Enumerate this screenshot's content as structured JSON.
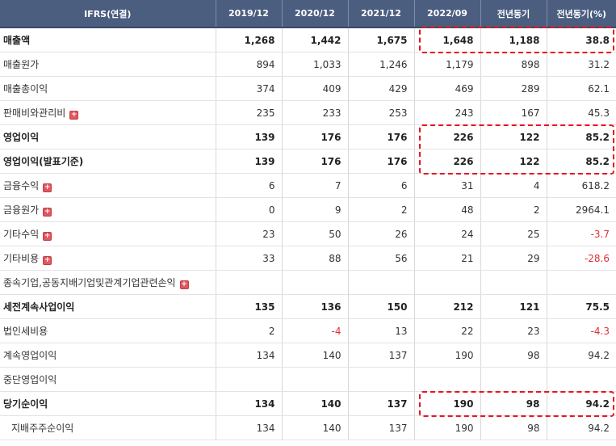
{
  "header": {
    "label": "IFRS(연결)",
    "periods": [
      "2019/12",
      "2020/12",
      "2021/12",
      "2022/09",
      "전년동기",
      "전년동기(%)"
    ]
  },
  "rows": [
    {
      "label": "매출액",
      "values": [
        "1,268",
        "1,442",
        "1,675",
        "1,648",
        "1,188",
        "38.8"
      ],
      "bold": true,
      "expandable": false
    },
    {
      "label": "매출원가",
      "values": [
        "894",
        "1,033",
        "1,246",
        "1,179",
        "898",
        "31.2"
      ],
      "bold": false,
      "expandable": false
    },
    {
      "label": "매출총이익",
      "values": [
        "374",
        "409",
        "429",
        "469",
        "289",
        "62.1"
      ],
      "bold": false,
      "expandable": false
    },
    {
      "label": "판매비와관리비",
      "values": [
        "235",
        "233",
        "253",
        "243",
        "167",
        "45.3"
      ],
      "bold": false,
      "expandable": true
    },
    {
      "label": "영업이익",
      "values": [
        "139",
        "176",
        "176",
        "226",
        "122",
        "85.2"
      ],
      "bold": true,
      "expandable": false
    },
    {
      "label": "영업이익(발표기준)",
      "values": [
        "139",
        "176",
        "176",
        "226",
        "122",
        "85.2"
      ],
      "bold": true,
      "expandable": false
    },
    {
      "label": "금융수익",
      "values": [
        "6",
        "7",
        "6",
        "31",
        "4",
        "618.2"
      ],
      "bold": false,
      "expandable": true
    },
    {
      "label": "금융원가",
      "values": [
        "0",
        "9",
        "2",
        "48",
        "2",
        "2964.1"
      ],
      "bold": false,
      "expandable": true
    },
    {
      "label": "기타수익",
      "values": [
        "23",
        "50",
        "26",
        "24",
        "25",
        "-3.7"
      ],
      "bold": false,
      "expandable": true
    },
    {
      "label": "기타비용",
      "values": [
        "33",
        "88",
        "56",
        "21",
        "29",
        "-28.6"
      ],
      "bold": false,
      "expandable": true
    },
    {
      "label": "종속기업,공동지배기업및관계기업관련손익",
      "values": [
        "",
        "",
        "",
        "",
        "",
        ""
      ],
      "bold": false,
      "expandable": true
    },
    {
      "label": "세전계속사업이익",
      "values": [
        "135",
        "136",
        "150",
        "212",
        "121",
        "75.5"
      ],
      "bold": true,
      "expandable": false
    },
    {
      "label": "법인세비용",
      "values": [
        "2",
        "-4",
        "13",
        "22",
        "23",
        "-4.3"
      ],
      "bold": false,
      "expandable": false
    },
    {
      "label": "계속영업이익",
      "values": [
        "134",
        "140",
        "137",
        "190",
        "98",
        "94.2"
      ],
      "bold": false,
      "expandable": false
    },
    {
      "label": "중단영업이익",
      "values": [
        "",
        "",
        "",
        "",
        "",
        ""
      ],
      "bold": false,
      "expandable": false
    },
    {
      "label": "당기순이익",
      "values": [
        "134",
        "140",
        "137",
        "190",
        "98",
        "94.2"
      ],
      "bold": true,
      "expandable": false
    },
    {
      "label": "지배주주순이익",
      "values": [
        "134",
        "140",
        "137",
        "190",
        "98",
        "94.2"
      ],
      "bold": false,
      "expandable": false,
      "indent": true
    }
  ],
  "colors": {
    "header_bg": "#4b5e7f",
    "negative": "#e03030",
    "highlight_box": "#e8141f",
    "expand_icon": "#e0575e"
  },
  "icons": {
    "expand": "plus-icon"
  },
  "highlights": [
    {
      "rows": [
        0
      ],
      "columns": [
        "2022/09",
        "전년동기",
        "전년동기(%)"
      ]
    },
    {
      "rows": [
        4,
        5
      ],
      "columns": [
        "2022/09",
        "전년동기",
        "전년동기(%)"
      ]
    },
    {
      "rows": [
        15
      ],
      "columns": [
        "2022/09",
        "전년동기",
        "전년동기(%)"
      ]
    }
  ]
}
